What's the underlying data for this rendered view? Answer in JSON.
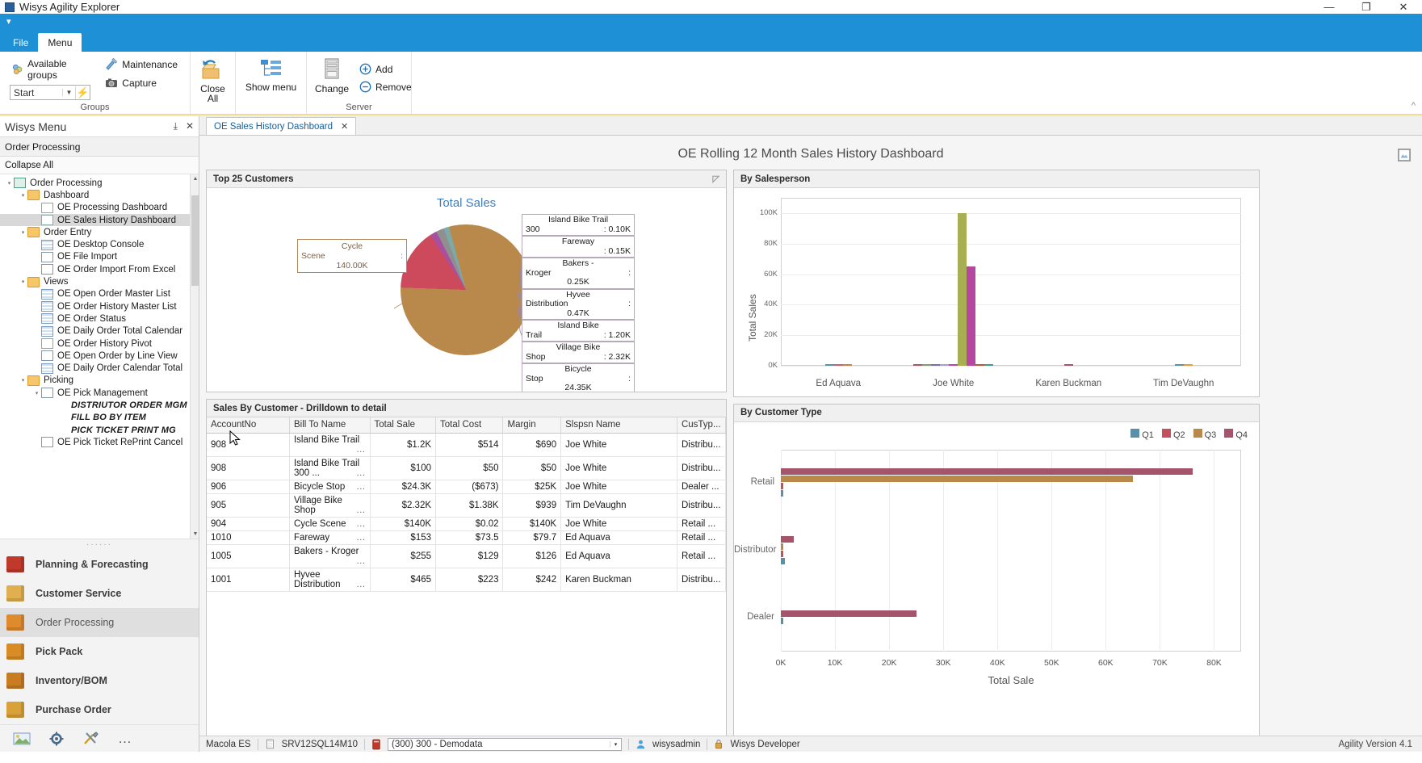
{
  "window": {
    "title": "Wisys Agility Explorer",
    "minimize": "—",
    "maximize": "❐",
    "close": "✕"
  },
  "ribbon": {
    "quick_access_glyph": "▾",
    "tabs": [
      {
        "label": "File",
        "active": false
      },
      {
        "label": "Menu",
        "active": true
      }
    ],
    "groups": [
      {
        "label": "Groups",
        "items": [
          "Available groups",
          "Start",
          "Maintenance",
          "Capture",
          "Close All"
        ]
      },
      {
        "label": "",
        "items": [
          "Show menu"
        ]
      },
      {
        "label": "Server",
        "items": [
          "Change",
          "Add",
          "Remove"
        ]
      }
    ],
    "available_groups_label": "Available groups",
    "start_combo_value": "Start",
    "maintenance_label": "Maintenance",
    "capture_label": "Capture",
    "close_all_label": "Close\nAll",
    "close_all_line1": "Close",
    "close_all_line2": "All",
    "show_menu_label": "Show menu",
    "change_label": "Change",
    "add_label": "Add",
    "remove_label": "Remove",
    "groups_group_label": "Groups",
    "server_group_label": "Server"
  },
  "sidebar": {
    "header_title": "Wisys Menu",
    "pin_glyph": "⤓",
    "close_glyph": "✕",
    "context": "Order Processing",
    "collapse_all": "Collapse All",
    "tree": [
      {
        "label": "Order Processing",
        "indent": 0,
        "icon": "root-icon",
        "expander": "◢",
        "selected": false,
        "italic": false
      },
      {
        "label": "Dashboard",
        "indent": 1,
        "icon": "folder-icon",
        "expander": "◢",
        "selected": false,
        "italic": false
      },
      {
        "label": "OE Processing Dashboard",
        "indent": 2,
        "icon": "chart-icon",
        "expander": "",
        "selected": false,
        "italic": false
      },
      {
        "label": "OE Sales History Dashboard",
        "indent": 2,
        "icon": "chart-icon",
        "expander": "",
        "selected": true,
        "italic": false
      },
      {
        "label": "Order Entry",
        "indent": 1,
        "icon": "folder-icon",
        "expander": "◢",
        "selected": false,
        "italic": false
      },
      {
        "label": "OE Desktop Console",
        "indent": 2,
        "icon": "grid-icon",
        "expander": "",
        "selected": false,
        "italic": false
      },
      {
        "label": "OE File Import",
        "indent": 2,
        "icon": "window-icon",
        "expander": "",
        "selected": false,
        "italic": false
      },
      {
        "label": "OE Order Import From Excel",
        "indent": 2,
        "icon": "excel-icon",
        "expander": "",
        "selected": false,
        "italic": false
      },
      {
        "label": "Views",
        "indent": 1,
        "icon": "folder-icon",
        "expander": "◢",
        "selected": false,
        "italic": false
      },
      {
        "label": "OE Open Order Master List",
        "indent": 2,
        "icon": "grid-icon",
        "expander": "",
        "selected": false,
        "italic": false
      },
      {
        "label": "OE Order History Master List",
        "indent": 2,
        "icon": "grid-icon",
        "expander": "",
        "selected": false,
        "italic": false
      },
      {
        "label": "OE Order Status",
        "indent": 2,
        "icon": "grid-icon",
        "expander": "",
        "selected": false,
        "italic": false
      },
      {
        "label": "OE Daily Order Total Calendar",
        "indent": 2,
        "icon": "calendar-icon",
        "expander": "",
        "selected": false,
        "italic": false
      },
      {
        "label": "OE Order History Pivot",
        "indent": 2,
        "icon": "chart-icon",
        "expander": "",
        "selected": false,
        "italic": false
      },
      {
        "label": "OE Open Order by Line View",
        "indent": 2,
        "icon": "list-icon",
        "expander": "",
        "selected": false,
        "italic": false
      },
      {
        "label": "OE Daily Order Calendar Total",
        "indent": 2,
        "icon": "calendar-icon",
        "expander": "",
        "selected": false,
        "italic": false
      },
      {
        "label": "Picking",
        "indent": 1,
        "icon": "folder-icon",
        "expander": "◢",
        "selected": false,
        "italic": false
      },
      {
        "label": "OE Pick Management",
        "indent": 2,
        "icon": "window-icon",
        "expander": "◢",
        "selected": false,
        "italic": false
      },
      {
        "label": "DISTRIUTOR ORDER MGM",
        "indent": 3,
        "icon": "",
        "expander": "",
        "selected": false,
        "italic": true
      },
      {
        "label": "FILL BO BY ITEM",
        "indent": 3,
        "icon": "",
        "expander": "",
        "selected": false,
        "italic": true
      },
      {
        "label": "PICK TICKET PRINT MG",
        "indent": 3,
        "icon": "",
        "expander": "",
        "selected": false,
        "italic": true
      },
      {
        "label": "OE Pick Ticket RePrint Cancel",
        "indent": 2,
        "icon": "window-icon",
        "expander": "",
        "selected": false,
        "italic": false
      }
    ],
    "splitter_dots": "······",
    "nav": [
      {
        "label": "Planning & Forecasting",
        "icon": "calendar-icon",
        "selected": false,
        "color": "#c0392b"
      },
      {
        "label": "Customer Service",
        "icon": "clipboard-icon",
        "selected": false,
        "color": "#e0b050"
      },
      {
        "label": "Order Processing",
        "icon": "orders-icon",
        "selected": true,
        "color": "#e08a2e"
      },
      {
        "label": "Pick Pack",
        "icon": "box-icon",
        "selected": false,
        "color": "#d98c25"
      },
      {
        "label": "Inventory/BOM",
        "icon": "inventory-icon",
        "selected": false,
        "color": "#c87d22"
      },
      {
        "label": "Purchase Order",
        "icon": "po-icon",
        "selected": false,
        "color": "#d9a13a"
      }
    ],
    "bottom_icons": [
      "photo-icon",
      "gear-icon",
      "tools-icon",
      "overflow-icon"
    ],
    "overflow_glyph": "…"
  },
  "document": {
    "tab_label": "OE Sales History Dashboard",
    "tab_close": "✕",
    "dashboard_title": "OE Rolling 12 Month Sales History Dashboard",
    "export_icon": "export-icon"
  },
  "panels": {
    "top_customers": {
      "title": "Top 25 Customers"
    },
    "sales_by_customer": {
      "title": "Sales By Customer - Drilldown to detail"
    },
    "by_salesperson": {
      "title": "By Salesperson"
    },
    "by_customer_type": {
      "title": "By Customer Type"
    }
  },
  "table": {
    "columns": [
      "AccountNo",
      "Bill To Name",
      "Total Sale",
      "Total Cost",
      "Margin",
      "Slspsn Name",
      "CusTyp..."
    ],
    "rows": [
      [
        "908",
        "Island Bike Trail",
        "$1.2K",
        "$514",
        "$690",
        "Joe White",
        "Distribu..."
      ],
      [
        "908",
        "Island Bike Trail 300 ...",
        "$100",
        "$50",
        "$50",
        "Joe White",
        "Distribu..."
      ],
      [
        "906",
        "Bicycle Stop",
        "$24.3K",
        "($673)",
        "$25K",
        "Joe White",
        "Dealer  ..."
      ],
      [
        "905",
        "Village Bike Shop",
        "$2.32K",
        "$1.38K",
        "$939",
        "Tim DeVaughn",
        "Distribu..."
      ],
      [
        "904",
        "Cycle Scene",
        "$140K",
        "$0.02",
        "$140K",
        "Joe White",
        "Retail  ..."
      ],
      [
        "1010",
        "Fareway",
        "$153",
        "$73.5",
        "$79.7",
        "Ed Aquava",
        "Retail  ..."
      ],
      [
        "1005",
        "Bakers - Kroger",
        "$255",
        "$129",
        "$126",
        "Ed Aquava",
        "Retail  ..."
      ],
      [
        "1001",
        "Hyvee Distribution",
        "$465",
        "$223",
        "$242",
        "Karen Buckman",
        "Distribu..."
      ]
    ],
    "ellipsis": "…"
  },
  "chart_data": [
    {
      "type": "pie",
      "title": "Total Sales",
      "panel": "Top 25 Customers",
      "unit": "K",
      "slices": [
        {
          "label": "Cycle Scene",
          "value": 140.0,
          "display": "140.00K",
          "color": "#b8894a"
        },
        {
          "label": "Bicycle Stop",
          "value": 24.35,
          "display": "24.35K",
          "color": "#cc4a5c"
        },
        {
          "label": "Village Bike Shop",
          "value": 2.32,
          "display": "2.32K",
          "color": "#b169ab"
        },
        {
          "label": "Island Bike Trail",
          "value": 1.2,
          "display": "1.20K",
          "color": "#8f8f8f"
        },
        {
          "label": "Hyvee Distribution",
          "value": 0.47,
          "display": "0.47K",
          "color": "#8a9a6e"
        },
        {
          "label": "Bakers - Kroger",
          "value": 0.25,
          "display": "0.25K",
          "color": "#6f9e9e"
        },
        {
          "label": "Fareway",
          "value": 0.15,
          "display": "0.15K",
          "color": "#a4556c"
        },
        {
          "label": "Island Bike Trail 300",
          "value": 0.1,
          "display": "0.10K",
          "color": "#7a6fa8"
        }
      ],
      "callouts": [
        {
          "name": "Cycle Scene",
          "name_line1": "Cycle",
          "name_line2": "Scene",
          "sep": ":",
          "value": "140.00K",
          "side": "left"
        },
        {
          "name": "Island Bike Trail 300",
          "name_line1": "Island Bike Trail",
          "name_line2": "300",
          "sep": "",
          "value": ": 0.10K",
          "side": "right"
        },
        {
          "name": "Fareway",
          "name_line1": "Fareway",
          "name_line2": "",
          "sep": "",
          "value": ": 0.15K",
          "side": "right"
        },
        {
          "name": "Bakers - Kroger",
          "name_line1": "Bakers -",
          "name_line2": "Kroger",
          "sep": ":",
          "value": "0.25K",
          "side": "right"
        },
        {
          "name": "Hyvee Distribution",
          "name_line1": "Hyvee",
          "name_line2": "Distribution",
          "sep": ":",
          "value": "0.47K",
          "side": "right"
        },
        {
          "name": "Island Bike Trail",
          "name_line1": "Island Bike",
          "name_line2": "Trail",
          "sep": "",
          "value": ": 1.20K",
          "side": "right"
        },
        {
          "name": "Village Bike Shop",
          "name_line1": "Village Bike",
          "name_line2": "Shop",
          "sep": "",
          "value": ": 2.32K",
          "side": "right"
        },
        {
          "name": "Bicycle Stop",
          "name_line1": "Bicycle",
          "name_line2": "Stop",
          "sep": ":",
          "value": "24.35K",
          "side": "right"
        }
      ]
    },
    {
      "type": "bar",
      "panel": "By Salesperson",
      "ylabel": "Total Sales",
      "xlabel": "",
      "categories": [
        "Ed Aquava",
        "Joe White",
        "Karen Buckman",
        "Tim DeVaughn"
      ],
      "yticks": [
        "0K",
        "20K",
        "40K",
        "60K",
        "80K",
        "100K"
      ],
      "ylim": [
        0,
        110
      ],
      "grid": true,
      "bars": [
        {
          "category": "Ed Aquava",
          "value": 0.3,
          "color": "#5a8fa8"
        },
        {
          "category": "Ed Aquava",
          "value": 0.2,
          "color": "#c4626e"
        },
        {
          "category": "Ed Aquava",
          "value": 0.2,
          "color": "#b8894a"
        },
        {
          "category": "Joe White",
          "value": 0.6,
          "color": "#a4556c"
        },
        {
          "category": "Joe White",
          "value": 0.4,
          "color": "#8a9a6e"
        },
        {
          "category": "Joe White",
          "value": 0.5,
          "color": "#7a6fa8"
        },
        {
          "category": "Joe White",
          "value": 0.5,
          "color": "#a8a0c8"
        },
        {
          "category": "Joe White",
          "value": 1.0,
          "color": "#b846b0"
        },
        {
          "category": "Joe White",
          "value": 100.0,
          "color": "#a8af52"
        },
        {
          "category": "Joe White",
          "value": 65.0,
          "color": "#b5479f"
        },
        {
          "category": "Joe White",
          "value": 0.6,
          "color": "#b05c3a"
        },
        {
          "category": "Joe White",
          "value": 0.4,
          "color": "#3f9e8a"
        },
        {
          "category": "Karen Buckman",
          "value": 0.5,
          "color": "#a4556c"
        },
        {
          "category": "Tim DeVaughn",
          "value": 0.5,
          "color": "#5a8fa8"
        },
        {
          "category": "Tim DeVaughn",
          "value": 1.0,
          "color": "#e0a040"
        }
      ]
    },
    {
      "type": "bar",
      "orientation": "horizontal",
      "panel": "By Customer Type",
      "xlabel": "Total Sale",
      "ylabel": "",
      "categories": [
        "Retail",
        "Distributor",
        "Dealer"
      ],
      "xticks": [
        "0K",
        "10K",
        "20K",
        "30K",
        "40K",
        "50K",
        "60K",
        "70K",
        "80K"
      ],
      "xlim": [
        0,
        85
      ],
      "legend": [
        {
          "label": "Q1",
          "color": "#5a8fa8"
        },
        {
          "label": "Q2",
          "color": "#c4505c"
        },
        {
          "label": "Q3",
          "color": "#b8894a"
        },
        {
          "label": "Q4",
          "color": "#a4556c"
        }
      ],
      "groups": [
        {
          "category": "Retail",
          "bars": [
            {
              "series": "Q4",
              "value": 76.0,
              "color": "#a4556c"
            },
            {
              "series": "Q3",
              "value": 65.0,
              "color": "#b8894a"
            },
            {
              "series": "Q2",
              "value": 0.2,
              "color": "#c4505c"
            },
            {
              "series": "Q1",
              "value": 0.4,
              "color": "#5a8fa8"
            }
          ]
        },
        {
          "category": "Distributor",
          "bars": [
            {
              "series": "Q4",
              "value": 2.4,
              "color": "#a4556c"
            },
            {
              "series": "Q3",
              "value": 0.3,
              "color": "#b8894a"
            },
            {
              "series": "Q2",
              "value": 0.5,
              "color": "#c4505c"
            },
            {
              "series": "Q1",
              "value": 0.7,
              "color": "#5a8fa8"
            }
          ]
        },
        {
          "category": "Dealer",
          "bars": [
            {
              "series": "Q4",
              "value": 25.0,
              "color": "#a4556c"
            },
            {
              "series": "Q1",
              "value": 0.3,
              "color": "#5a8fa8"
            }
          ]
        }
      ]
    }
  ],
  "status": {
    "left_label": "Macola ES",
    "server": "SRV12SQL14M10",
    "db_icon": "database-icon",
    "company_combo": "(300) 300 - Demodata",
    "combo_arrow": "▾",
    "user": "wisysadmin",
    "user_icon": "user-icon",
    "role": "Wisys Developer",
    "role_icon": "lock-icon",
    "version": "Agility Version 4.1"
  }
}
